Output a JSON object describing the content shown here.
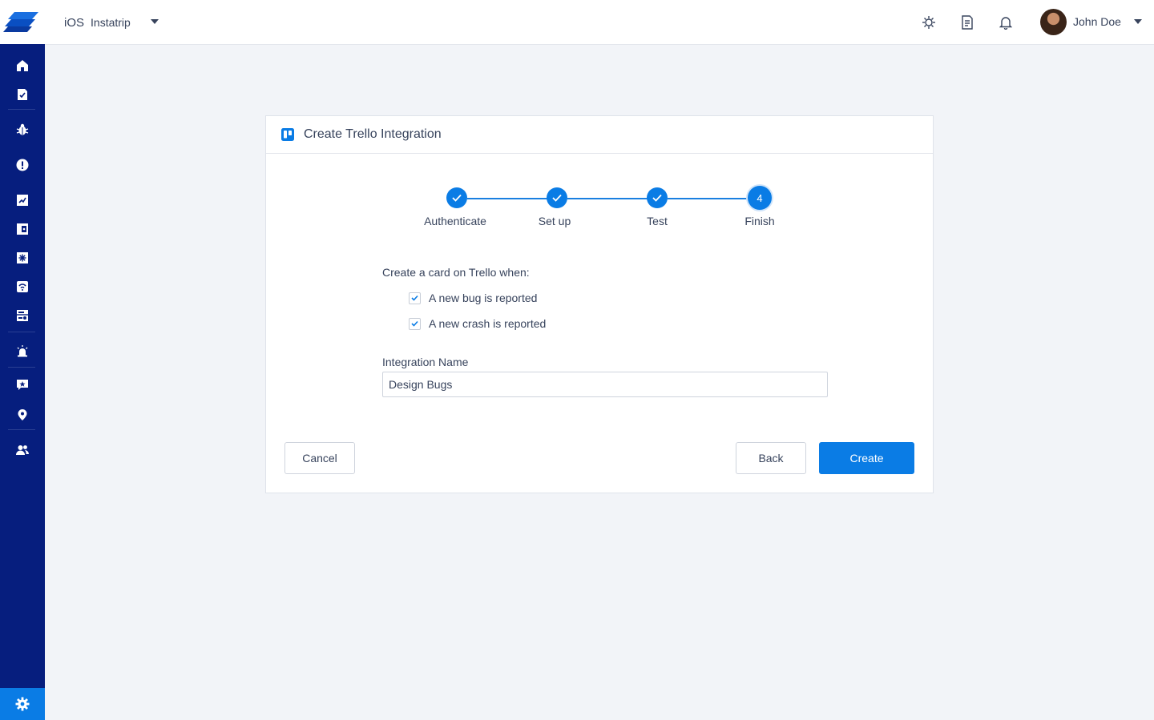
{
  "header": {
    "app_platform": "iOS",
    "app_name": "Instatrip",
    "user_name": "John Doe",
    "icons": [
      "debug-icon",
      "docs-icon",
      "notifications-bell-icon"
    ]
  },
  "sidebar": {
    "items": [
      "home-icon",
      "release-notes-icon",
      "bugs-icon",
      "crashes-icon",
      "surveys-icon",
      "app-ratings-icon",
      "feature-requests-icon",
      "announcements-icon",
      "in-app-chat-icon",
      "alerts-icon",
      "reviews-icon",
      "location-icon",
      "team-icon"
    ],
    "settings": "settings-gear-icon",
    "accent": "#0a7ce5",
    "background": "#061e7e"
  },
  "dialog": {
    "title": "Create Trello Integration",
    "steps": [
      {
        "label": "Authenticate",
        "state": "done"
      },
      {
        "label": "Set up",
        "state": "done"
      },
      {
        "label": "Test",
        "state": "done"
      },
      {
        "label": "Finish",
        "state": "current",
        "number": "4"
      }
    ],
    "trigger_heading": "Create a card on Trello when:",
    "triggers": [
      {
        "label": "A new bug is reported",
        "checked": true
      },
      {
        "label": "A new crash is reported",
        "checked": true
      }
    ],
    "name_label": "Integration Name",
    "name_value": "Design Bugs",
    "cancel_label": "Cancel",
    "back_label": "Back",
    "create_label": "Create"
  }
}
